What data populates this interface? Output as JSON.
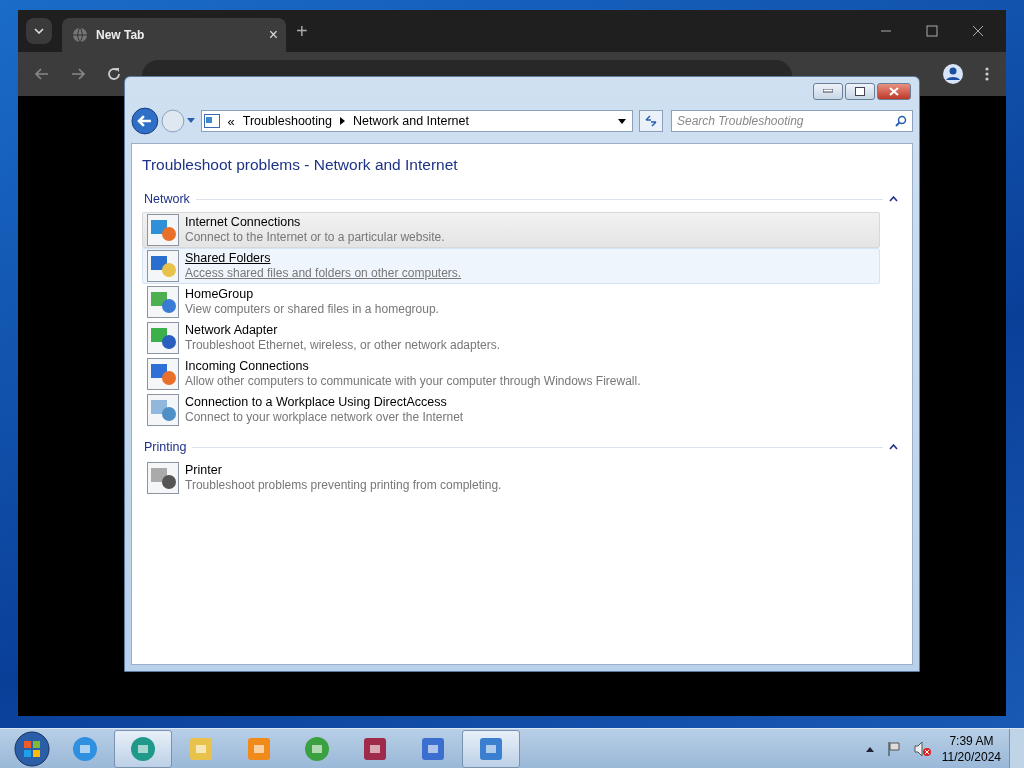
{
  "browser": {
    "tab": {
      "title": "New Tab",
      "close": "×"
    },
    "new_tab": "+"
  },
  "explorer": {
    "breadcrumb": [
      "Troubleshooting",
      "Network and Internet"
    ],
    "breadcrumb_prefix": "«",
    "search": {
      "placeholder": "Search Troubleshooting"
    },
    "heading": "Troubleshoot problems - Network and Internet",
    "sections": [
      {
        "title": "Network",
        "expanded": true,
        "items": [
          {
            "kind": "internet",
            "title": "Internet Connections",
            "desc": "Connect to the Internet or to a particular website.",
            "selected": true,
            "hovered": false
          },
          {
            "kind": "shared",
            "title": "Shared Folders",
            "desc": "Access shared files and folders on other computers.",
            "selected": false,
            "hovered": true
          },
          {
            "kind": "homegroup",
            "title": "HomeGroup",
            "desc": "View computers or shared files in a homegroup.",
            "selected": false,
            "hovered": false
          },
          {
            "kind": "adapter",
            "title": "Network Adapter",
            "desc": "Troubleshoot Ethernet, wireless, or other network adapters.",
            "selected": false,
            "hovered": false
          },
          {
            "kind": "incoming",
            "title": "Incoming Connections",
            "desc": "Allow other computers to communicate with your computer through Windows Firewall.",
            "selected": false,
            "hovered": false
          },
          {
            "kind": "workplace",
            "title": "Connection to a Workplace Using DirectAccess",
            "desc": "Connect to your workplace network over the Internet",
            "selected": false,
            "hovered": false
          }
        ]
      },
      {
        "title": "Printing",
        "expanded": true,
        "items": [
          {
            "kind": "printer",
            "title": "Printer",
            "desc": "Troubleshoot problems preventing printing from completing.",
            "selected": false,
            "hovered": false
          }
        ]
      }
    ]
  },
  "taskbar": {
    "apps": [
      {
        "kind": "ie",
        "active": false
      },
      {
        "kind": "chat",
        "active": true
      },
      {
        "kind": "folder",
        "active": false
      },
      {
        "kind": "media",
        "active": false
      },
      {
        "kind": "download",
        "active": false
      },
      {
        "kind": "archive",
        "active": false
      },
      {
        "kind": "network",
        "active": false
      },
      {
        "kind": "troubleshoot",
        "active": true
      }
    ],
    "time": "7:39 AM",
    "date": "11/20/2024"
  }
}
